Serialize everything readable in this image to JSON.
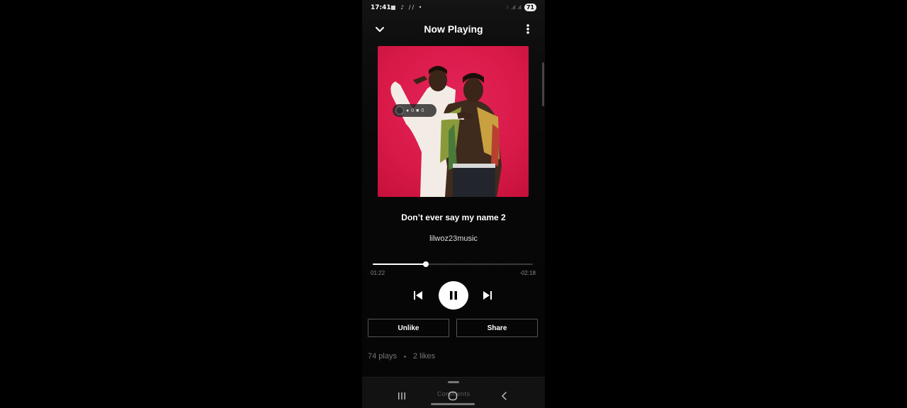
{
  "status_bar": {
    "time": "17:41",
    "left_icons": "■ ♪ // •",
    "signal": "⁙ .ıl .ıl",
    "battery": "71"
  },
  "header": {
    "title": "Now Playing"
  },
  "cover": {
    "overlay_stats": [
      "0",
      "0",
      "0"
    ],
    "colors": {
      "background": "#d91a48"
    }
  },
  "track": {
    "title": "Don’t ever say my name 2",
    "artist": "lilwoz23music"
  },
  "player": {
    "elapsed": "01:22",
    "remaining": "-02:18",
    "progress_fraction": 0.3333,
    "state": "playing"
  },
  "actions": {
    "unlike_label": "Unlike",
    "share_label": "Share"
  },
  "stats": {
    "plays": "74 plays",
    "likes": "2 likes"
  },
  "comments_sheet": {
    "title": "Comments"
  },
  "icons": {
    "header_left": "chevron-down-icon",
    "header_right": "more-vertical-icon",
    "prev": "skip-previous-icon",
    "play_pause": "pause-icon",
    "next": "skip-next-icon",
    "nav": [
      "recent-apps-icon",
      "home-icon",
      "back-icon"
    ]
  },
  "colors": {
    "accent": "#ffffff",
    "background": "#000000",
    "muted_text": "#777777"
  }
}
